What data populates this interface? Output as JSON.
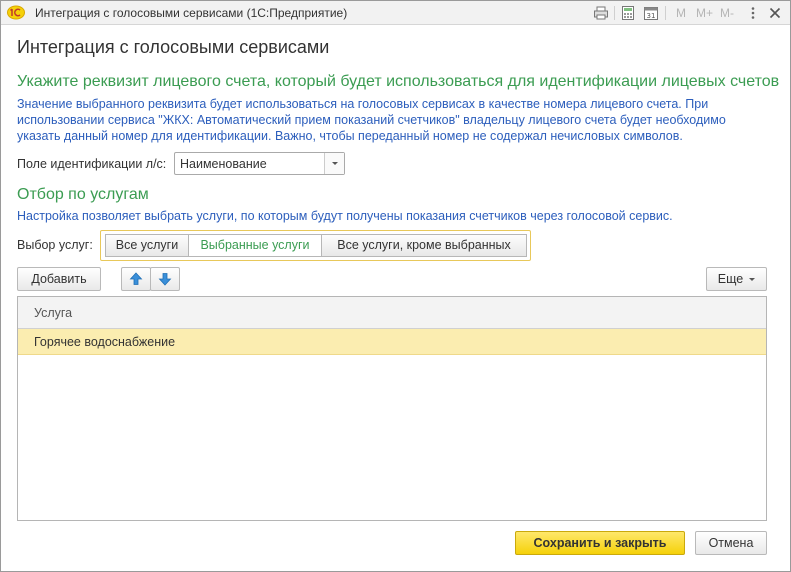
{
  "window": {
    "title": "Интеграция с голосовыми сервисами  (1С:Предприятие)",
    "toolbar": {
      "m": "M",
      "m_plus": "M+",
      "m_minus": "M-"
    }
  },
  "form": {
    "title": "Интеграция с голосовыми сервисами",
    "section1": {
      "heading": "Укажите реквизит лицевого счета, который будет использоваться для идентификации лицевых счетов",
      "note_lines": [
        "Значение выбранного реквизита будет использоваться на голосовых сервисах в качестве номера лицевого счета. При",
        "использовании сервиса \"ЖКХ: Автоматический прием показаний счетчиков\" владельцу лицевого счета будет необходимо",
        "указать данный номер для идентификации. Важно, чтобы переданный номер не содержал нечисловых символов."
      ],
      "field_label": "Поле идентификации л/с:",
      "field_value": "Наименование"
    },
    "section2": {
      "heading": "Отбор по услугам",
      "note": "Настройка позволяет выбрать услуги, по которым будут получены показания счетчиков через голосовой сервис.",
      "choice_label": "Выбор услуг:",
      "options": [
        "Все услуги",
        "Выбранные услуги",
        "Все услуги, кроме выбранных"
      ],
      "selected_index": 1
    },
    "toolbar": {
      "add": "Добавить",
      "more": "Еще"
    },
    "table": {
      "column": "Услуга",
      "rows": [
        "Горячее водоснабжение"
      ]
    },
    "footer": {
      "save_close": "Сохранить и закрыть",
      "cancel": "Отмена"
    }
  }
}
